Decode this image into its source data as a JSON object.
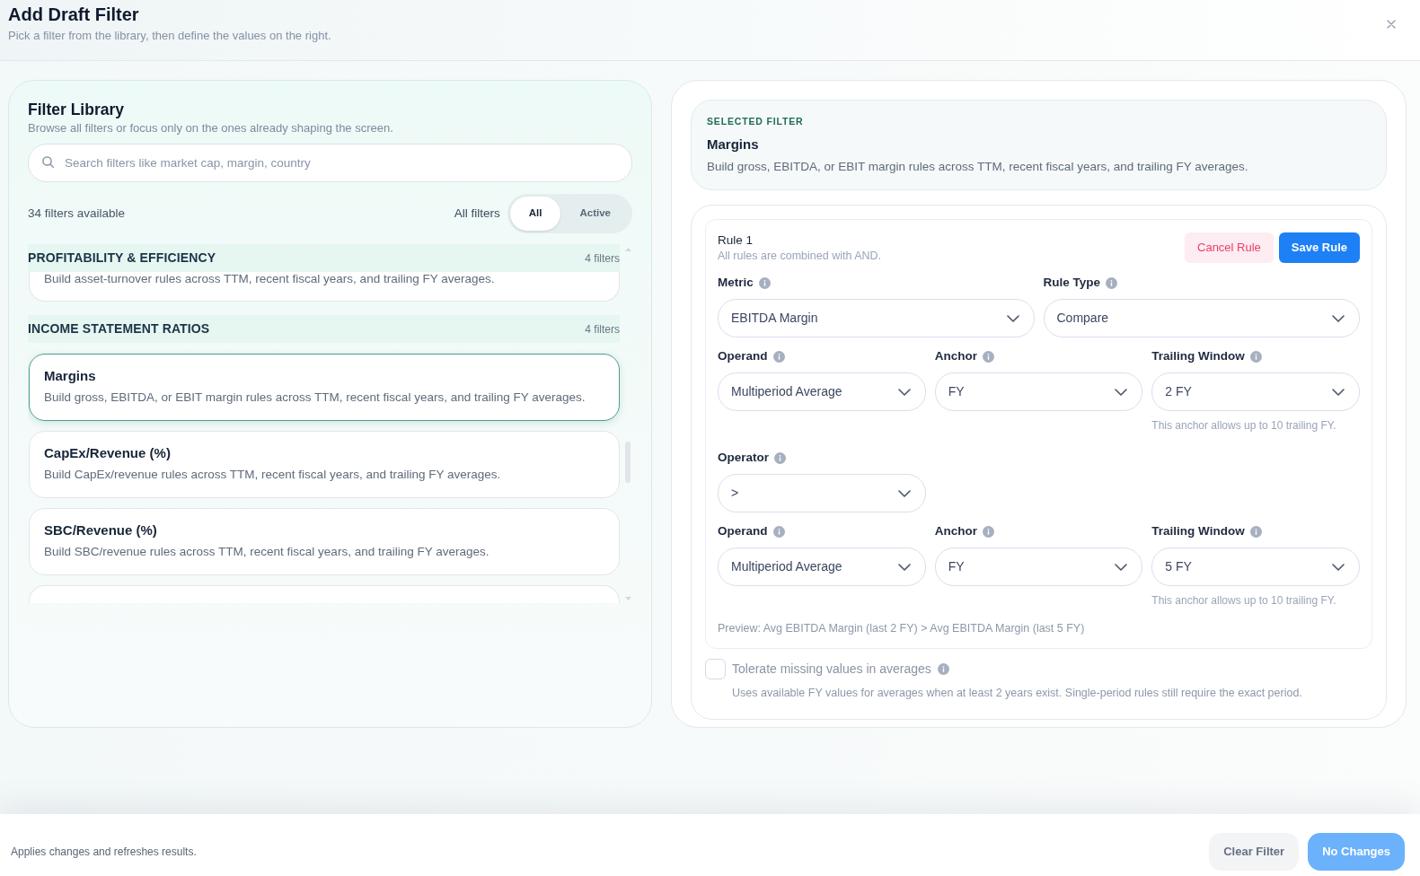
{
  "dialog": {
    "title": "Add Draft Filter",
    "subtitle": "Pick a filter from the library, then define the values on the right."
  },
  "library": {
    "title": "Filter Library",
    "subtitle": "Browse all filters or focus only on the ones already shaping the screen.",
    "search": {
      "placeholder": "Search filters like market cap, margin, country"
    },
    "count": "34 filters available",
    "scope_label": "All filters",
    "scope_tabs": [
      {
        "label": "All",
        "selected": true
      },
      {
        "label": "Active",
        "selected": false
      }
    ],
    "sections": [
      {
        "title": "PROFITABILITY & EFFICIENCY",
        "count": "4 filters",
        "cards": [
          {
            "kind": "cut_top",
            "description": "Build asset-turnover rules across TTM, recent fiscal years, and trailing FY averages.",
            "selected": false
          }
        ]
      },
      {
        "title": "INCOME STATEMENT RATIOS",
        "count": "4 filters",
        "cards": [
          {
            "kind": "full",
            "title": "Margins",
            "description": "Build gross, EBITDA, or EBIT margin rules across TTM, recent fiscal years, and trailing FY averages.",
            "selected": true
          },
          {
            "kind": "full",
            "title": "CapEx/Revenue (%)",
            "description": "Build CapEx/revenue rules across TTM, recent fiscal years, and trailing FY averages.",
            "selected": false
          },
          {
            "kind": "full",
            "title": "SBC/Revenue (%)",
            "description": "Build SBC/revenue rules across TTM, recent fiscal years, and trailing FY averages.",
            "selected": false
          },
          {
            "kind": "cut_bottom",
            "selected": false
          }
        ]
      }
    ]
  },
  "selected_filter": {
    "eyebrow": "SELECTED FILTER",
    "title": "Margins",
    "description": "Build gross, EBITDA, or EBIT margin rules across TTM, recent fiscal years, and trailing FY averages."
  },
  "rule": {
    "title": "Rule 1",
    "subtitle": "All rules are combined with AND.",
    "buttons": [
      {
        "label": "Cancel Rule",
        "kind": "danger"
      },
      {
        "label": "Save Rule",
        "kind": "primary"
      }
    ],
    "rows": [
      {
        "kind": "pair",
        "fields": [
          {
            "label": "Metric",
            "value": "EBITDA Margin"
          },
          {
            "label": "Rule Type",
            "value": "Compare"
          }
        ]
      },
      {
        "kind": "triple",
        "fields": [
          {
            "label": "Operand",
            "value": "Multiperiod Average"
          },
          {
            "label": "Anchor",
            "value": "FY"
          },
          {
            "label": "Trailing Window",
            "value": "2 FY",
            "hint": "This anchor allows up to 10 trailing FY."
          }
        ]
      },
      {
        "kind": "triple",
        "fields": [
          {
            "label": "Operator",
            "value": ">"
          }
        ]
      },
      {
        "kind": "triple",
        "fields": [
          {
            "label": "Operand",
            "value": "Multiperiod Average"
          },
          {
            "label": "Anchor",
            "value": "FY"
          },
          {
            "label": "Trailing Window",
            "value": "5 FY",
            "hint": "This anchor allows up to 10 trailing FY."
          }
        ]
      }
    ],
    "preview": "Preview: Avg EBITDA Margin (last 2 FY) > Avg EBITDA Margin (last 5 FY)",
    "option": {
      "label": "Tolerate missing values in averages",
      "checked": false,
      "description": "Uses available FY values for averages when at least 2 years exist. Single-period rules still require the exact period."
    }
  },
  "footer": {
    "note": "Applies changes and refreshes results.",
    "buttons": [
      {
        "label": "Clear Filter",
        "kind": "secondary",
        "disabled": false
      },
      {
        "label": "No Changes",
        "kind": "primary",
        "disabled": true
      }
    ]
  }
}
